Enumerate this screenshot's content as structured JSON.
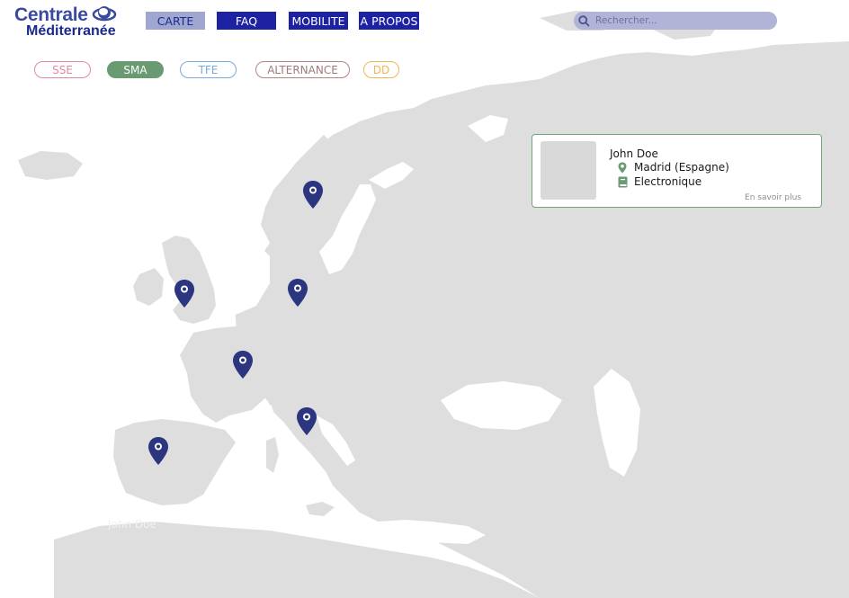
{
  "logo": {
    "line1": "Centrale",
    "line2": "Méditerranée"
  },
  "nav": {
    "carte": "CARTE",
    "faq": "FAQ",
    "mobilite": "MOBILITE",
    "apropos": "A PROPOS"
  },
  "search": {
    "placeholder": "Rechercher..."
  },
  "filters": {
    "sse": "SSE",
    "sma": "SMA",
    "tfe": "TFE",
    "alternance": "ALTERNANCE",
    "dd": "DD"
  },
  "colors": {
    "nav_active_bg": "#9fa6cf",
    "nav_bg": "#1d22a3",
    "land": "#dedede",
    "marker": "#2b3580",
    "sse": "#e28a9d",
    "sma": "#6a9a72",
    "tfe": "#7aa9e0",
    "alternance": "#b58484",
    "dd": "#f0b45a"
  },
  "markers": [
    {
      "name": "marker-sweden",
      "icon": "map-pin-icon"
    },
    {
      "name": "marker-uk",
      "icon": "map-pin-icon"
    },
    {
      "name": "marker-germany",
      "icon": "map-pin-icon"
    },
    {
      "name": "marker-france",
      "icon": "map-pin-icon"
    },
    {
      "name": "marker-italy",
      "icon": "map-pin-icon"
    },
    {
      "name": "marker-spain",
      "icon": "map-pin-icon"
    }
  ],
  "card": {
    "name": "John Doe",
    "location": "Madrid (Espagne)",
    "field": "Electronique",
    "more": "En savoir plus"
  },
  "ghost_label": "John Doe"
}
